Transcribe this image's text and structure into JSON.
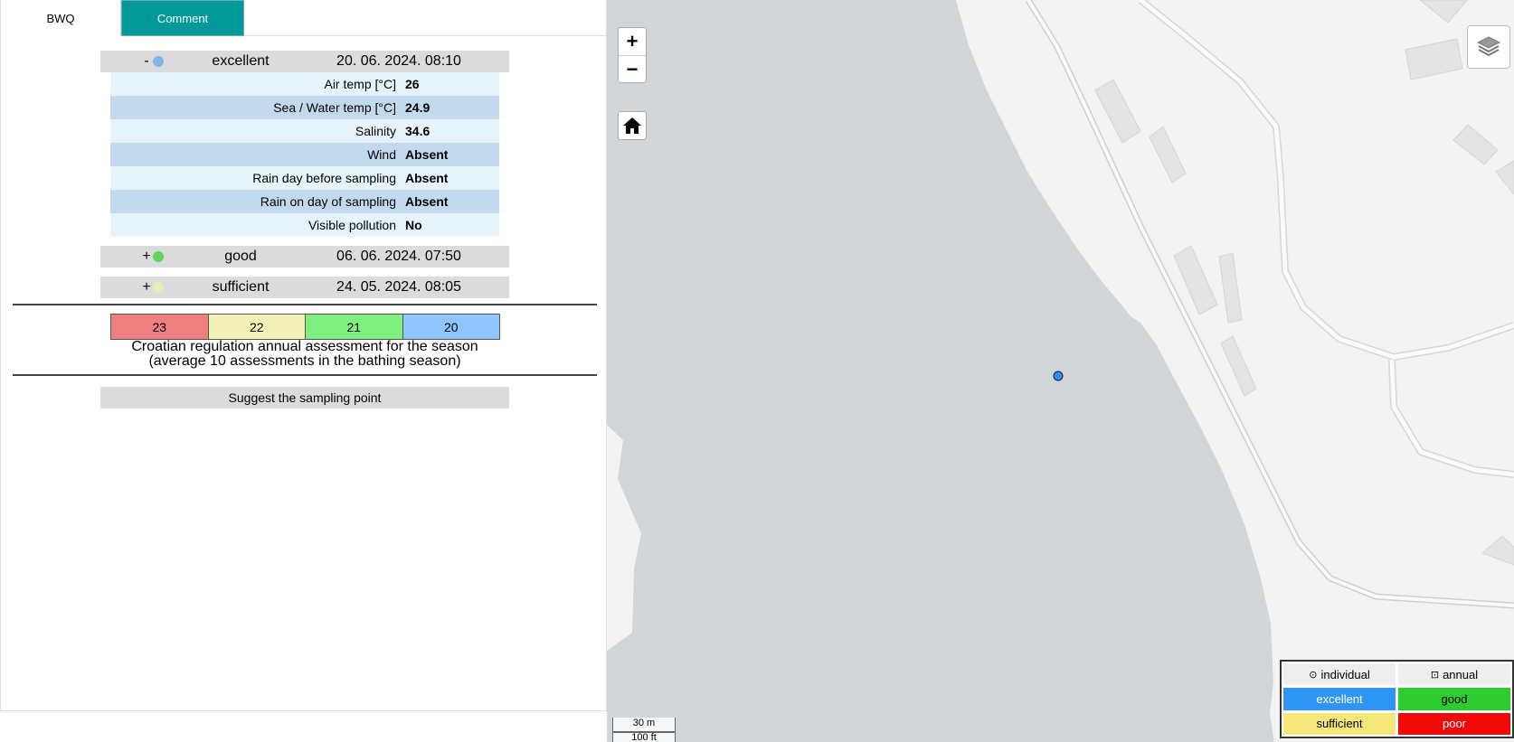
{
  "tabs": [
    {
      "label": "BWQ"
    },
    {
      "label": "Comment"
    }
  ],
  "samples": [
    {
      "toggle": "-",
      "class": "excellent",
      "datetime": "20. 06. 2024. 08:10",
      "color": "#7fb6e6"
    },
    {
      "toggle": "+",
      "class": "good",
      "datetime": "06. 06. 2024. 07:50",
      "color": "#5fd65f"
    },
    {
      "toggle": "+",
      "class": "sufficient",
      "datetime": "24. 05. 2024. 08:05",
      "color": "#efe9b6"
    }
  ],
  "details": [
    {
      "label": "Air temp [°C]",
      "value": "26"
    },
    {
      "label": "Sea / Water temp [°C]",
      "value": "24.9"
    },
    {
      "label": "Salinity",
      "value": "34.6"
    },
    {
      "label": "Wind",
      "value": "Absent"
    },
    {
      "label": "Rain day before sampling",
      "value": "Absent"
    },
    {
      "label": "Rain on day of sampling",
      "value": "Absent"
    },
    {
      "label": "Visible pollution",
      "value": "No"
    }
  ],
  "annual": [
    {
      "value": "23",
      "color": "#f07f7f"
    },
    {
      "value": "22",
      "color": "#f2f2b6"
    },
    {
      "value": "21",
      "color": "#7ff07f"
    },
    {
      "value": "20",
      "color": "#8fc6ff"
    }
  ],
  "regulation": {
    "line1": "Croatian regulation annual assessment for the season",
    "line2": "(average 10 assessments in the bathing season)"
  },
  "suggest_label": "Suggest the sampling point",
  "map": {
    "zoom_in": "+",
    "zoom_out": "−",
    "scale_metric": "30 m",
    "scale_imperial": "100 ft",
    "point_color": "#2f8ff0"
  },
  "legend": {
    "individual": "individual",
    "annual": "annual",
    "items": [
      {
        "label": "excellent",
        "bg": "#2f95f5",
        "fg": "#ffffff"
      },
      {
        "label": "good",
        "bg": "#2fcc2f",
        "fg": "#000000"
      },
      {
        "label": "sufficient",
        "bg": "#f5e87a",
        "fg": "#000000"
      },
      {
        "label": "poor",
        "bg": "#f00a0a",
        "fg": "#ffffff"
      }
    ]
  }
}
